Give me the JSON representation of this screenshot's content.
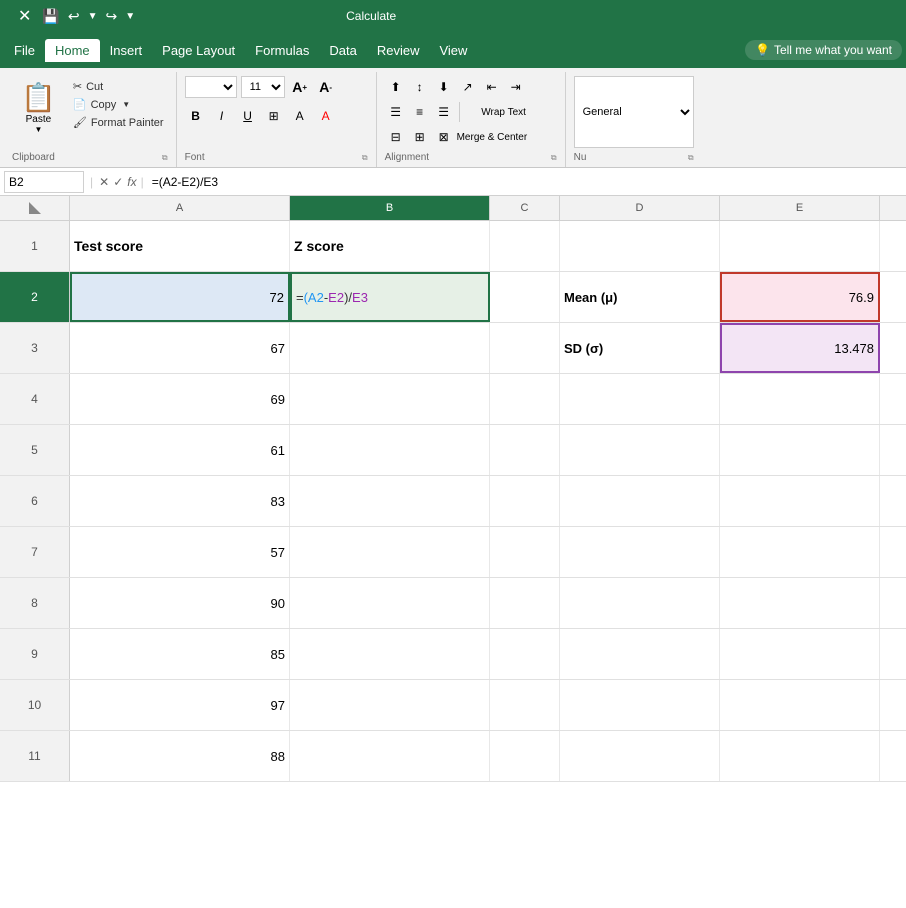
{
  "titlebar": {
    "title": "Calculate",
    "save_icon": "💾",
    "undo_icon": "↩",
    "redo_icon": "↪"
  },
  "menubar": {
    "items": [
      "File",
      "Home",
      "Insert",
      "Page Layout",
      "Formulas",
      "Data",
      "Review",
      "View"
    ],
    "active": "Home",
    "tell_me": "Tell me what you want"
  },
  "ribbon": {
    "clipboard": {
      "label": "Clipboard",
      "paste": "Paste",
      "cut": "Cut",
      "copy": "Copy",
      "format_painter": "Format Painter"
    },
    "font": {
      "label": "Font",
      "font_name": "",
      "font_size": "11",
      "bold": "B",
      "italic": "I",
      "underline": "U"
    },
    "alignment": {
      "label": "Alignment",
      "wrap_text": "Wrap Text",
      "merge_center": "Merge & Center"
    },
    "number": {
      "label": "Nu",
      "format": "General"
    }
  },
  "formula_bar": {
    "cell_ref": "B2",
    "formula": "=(A2-E2)/E3"
  },
  "spreadsheet": {
    "col_headers": [
      "A",
      "B",
      "C",
      "D",
      "E"
    ],
    "rows": [
      {
        "num": "1",
        "cells": [
          {
            "value": "Test score",
            "type": "header"
          },
          {
            "value": "Z score",
            "type": "header"
          },
          {
            "value": "",
            "type": "normal"
          },
          {
            "value": "",
            "type": "normal"
          },
          {
            "value": "",
            "type": "normal"
          }
        ]
      },
      {
        "num": "2",
        "cells": [
          {
            "value": "72",
            "type": "number"
          },
          {
            "value": "=(A2-E2)/E3",
            "type": "formula"
          },
          {
            "value": "",
            "type": "normal"
          },
          {
            "value": "Mean (μ)",
            "type": "bold"
          },
          {
            "value": "76.9",
            "type": "number-red"
          }
        ]
      },
      {
        "num": "3",
        "cells": [
          {
            "value": "67",
            "type": "number"
          },
          {
            "value": "",
            "type": "normal"
          },
          {
            "value": "",
            "type": "normal"
          },
          {
            "value": "SD (σ)",
            "type": "bold"
          },
          {
            "value": "13.478",
            "type": "number-purple"
          }
        ]
      },
      {
        "num": "4",
        "cells": [
          {
            "value": "69",
            "type": "number"
          },
          {
            "value": "",
            "type": "normal"
          },
          {
            "value": "",
            "type": "normal"
          },
          {
            "value": "",
            "type": "normal"
          },
          {
            "value": "",
            "type": "normal"
          }
        ]
      },
      {
        "num": "5",
        "cells": [
          {
            "value": "61",
            "type": "number"
          },
          {
            "value": "",
            "type": "normal"
          },
          {
            "value": "",
            "type": "normal"
          },
          {
            "value": "",
            "type": "normal"
          },
          {
            "value": "",
            "type": "normal"
          }
        ]
      },
      {
        "num": "6",
        "cells": [
          {
            "value": "83",
            "type": "number"
          },
          {
            "value": "",
            "type": "normal"
          },
          {
            "value": "",
            "type": "normal"
          },
          {
            "value": "",
            "type": "normal"
          },
          {
            "value": "",
            "type": "normal"
          }
        ]
      },
      {
        "num": "7",
        "cells": [
          {
            "value": "57",
            "type": "number"
          },
          {
            "value": "",
            "type": "normal"
          },
          {
            "value": "",
            "type": "normal"
          },
          {
            "value": "",
            "type": "normal"
          },
          {
            "value": "",
            "type": "normal"
          }
        ]
      },
      {
        "num": "8",
        "cells": [
          {
            "value": "90",
            "type": "number"
          },
          {
            "value": "",
            "type": "normal"
          },
          {
            "value": "",
            "type": "normal"
          },
          {
            "value": "",
            "type": "normal"
          },
          {
            "value": "",
            "type": "normal"
          }
        ]
      },
      {
        "num": "9",
        "cells": [
          {
            "value": "85",
            "type": "number"
          },
          {
            "value": "",
            "type": "normal"
          },
          {
            "value": "",
            "type": "normal"
          },
          {
            "value": "",
            "type": "normal"
          },
          {
            "value": "",
            "type": "normal"
          }
        ]
      },
      {
        "num": "10",
        "cells": [
          {
            "value": "97",
            "type": "number"
          },
          {
            "value": "",
            "type": "normal"
          },
          {
            "value": "",
            "type": "normal"
          },
          {
            "value": "",
            "type": "normal"
          },
          {
            "value": "",
            "type": "normal"
          }
        ]
      },
      {
        "num": "11",
        "cells": [
          {
            "value": "88",
            "type": "number"
          },
          {
            "value": "",
            "type": "normal"
          },
          {
            "value": "",
            "type": "normal"
          },
          {
            "value": "",
            "type": "normal"
          },
          {
            "value": "",
            "type": "normal"
          }
        ]
      }
    ]
  }
}
